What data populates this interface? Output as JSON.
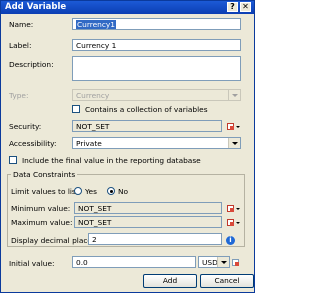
{
  "window": {
    "title": "Add Variable",
    "help_glyph": "?",
    "close_glyph": "✕"
  },
  "form": {
    "name_label": "Name:",
    "name_value": "Currency1",
    "label_label": "Label:",
    "label_value": "Currency 1",
    "description_label": "Description:",
    "description_value": "",
    "type_label": "Type:",
    "type_value": "Currency",
    "collection_label": "Contains a collection of variables",
    "security_label": "Security:",
    "security_value": "NOT_SET",
    "accessibility_label": "Accessibility:",
    "accessibility_value": "Private",
    "include_label": "Include the final value in the reporting database"
  },
  "constraints": {
    "title": "Data Constraints",
    "limit_label": "Limit values to list:",
    "yes_label": "Yes",
    "no_label": "No",
    "selected": "No",
    "min_label": "Minimum value:",
    "min_value": "NOT_SET",
    "max_label": "Maximum value:",
    "max_value": "NOT_SET",
    "decimal_label": "Display decimal places:",
    "decimal_value": "2",
    "info_glyph": "i"
  },
  "initial": {
    "label": "Initial value:",
    "value": "0.0",
    "currency": "USD"
  },
  "buttons": {
    "add": "Add",
    "cancel": "Cancel"
  },
  "icons": {
    "picker": "variable-picker-icon",
    "info": "info-icon"
  }
}
